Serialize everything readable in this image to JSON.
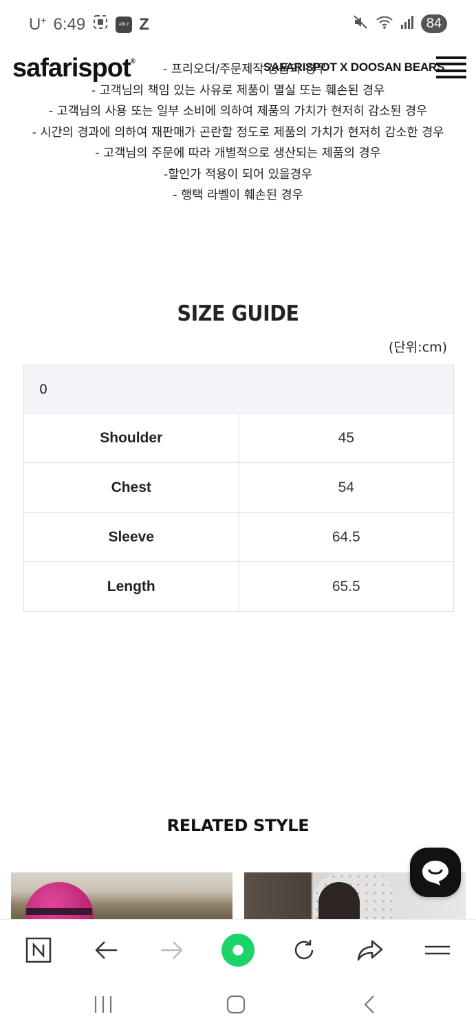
{
  "status_bar": {
    "carrier": "U",
    "carrier_mark": "+",
    "time": "6:49",
    "app_badge": "ABLY",
    "app_z": "Z",
    "battery": "84"
  },
  "header": {
    "logo": "safarispot",
    "logo_mark": "®",
    "collab_title": "SAFARISPOT X DOOSAN BEARS"
  },
  "notice_lines": [
    "- 프리오더/주문제작 상품의 경우",
    "- 고객님의 책임 있는 사유로 제품이 멸실 또는 훼손된 경우",
    "- 고객님의 사용 또는 일부 소비에 의하여 제품의 가치가 현저히 감소된 경우",
    "- 시간의 경과에 의하여 재판매가 곤란할 정도로 제품의 가치가 현저히 감소한 경우",
    "- 고객님의 주문에 따라 개별적으로 생산되는 제품의 경우",
    "-할인가 적용이 되어 있을경우",
    "- 행택 라벨이 훼손된 경우"
  ],
  "size_guide": {
    "title": "SIZE GUIDE",
    "unit": "(단위:cm)",
    "header_cell": "0",
    "rows": [
      {
        "label": "Shoulder",
        "value": "45"
      },
      {
        "label": "Chest",
        "value": "54"
      },
      {
        "label": "Sleeve",
        "value": "64.5"
      },
      {
        "label": "Length",
        "value": "65.5"
      }
    ]
  },
  "related": {
    "title": "RELATED STYLE"
  },
  "toolbar": {
    "n_label": "N"
  },
  "colors": {
    "accent_green": "#19d466",
    "text": "#222222",
    "table_border": "#dddddd",
    "table_head_bg": "#f4f5f8"
  }
}
